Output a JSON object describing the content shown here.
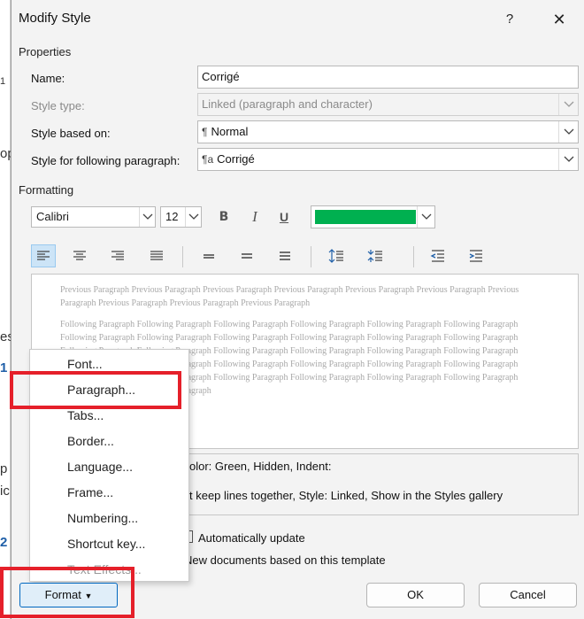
{
  "background": {
    "fragments": [
      "1",
      "op",
      "es",
      "1",
      "p",
      "ic",
      "2"
    ]
  },
  "dialog": {
    "title": "Modify Style",
    "help": "?",
    "close": "✕"
  },
  "properties": {
    "section": "Properties",
    "name_label": "Name:",
    "name_value": "Corrigé",
    "style_type_label": "Style type:",
    "style_type_value": "Linked (paragraph and character)",
    "based_on_label": "Style based on:",
    "based_on_glyph": "¶",
    "based_on_value": "Normal",
    "following_label": "Style for following paragraph:",
    "following_glyph": "¶a",
    "following_value": "Corrigé"
  },
  "formatting": {
    "section": "Formatting",
    "font": "Calibri",
    "size": "12",
    "bold": "B",
    "italic": "I",
    "underline": "U",
    "font_color": "#00b050"
  },
  "preview": {
    "previous_text": "Previous Paragraph Previous Paragraph Previous Paragraph Previous Paragraph Previous Paragraph Previous Paragraph Previous Paragraph Previous Paragraph Previous Paragraph Previous Paragraph",
    "following_text": "Following Paragraph Following Paragraph Following Paragraph Following Paragraph Following Paragraph Following Paragraph Following Paragraph Following Paragraph Following Paragraph Following Paragraph Following Paragraph Following Paragraph Following Paragraph Following Paragraph Following Paragraph Following Paragraph Following Paragraph Following Paragraph Following Paragraph Following Paragraph Following Paragraph Following Paragraph Following Paragraph Following Paragraph Following Paragraph Following Paragraph Following Paragraph Following Paragraph Following Paragraph Following Paragraph Following Paragraph Following Paragraph"
  },
  "description": {
    "line1": "olor: Green, Hidden, Indent:",
    "line2": "t keep lines together, Style: Linked, Show in the Styles gallery"
  },
  "options": {
    "auto_update": "Automatically update",
    "new_docs": "New documents based on this template"
  },
  "buttons": {
    "format": "Format",
    "ok": "OK",
    "cancel": "Cancel"
  },
  "format_menu": {
    "items": [
      "Font...",
      "Paragraph...",
      "Tabs...",
      "Border...",
      "Language...",
      "Frame...",
      "Numbering...",
      "Shortcut key...",
      "Text Effects..."
    ],
    "highlighted": "Paragraph..."
  },
  "colors": {
    "highlight": "#e5202a",
    "accent": "#0067c0"
  }
}
